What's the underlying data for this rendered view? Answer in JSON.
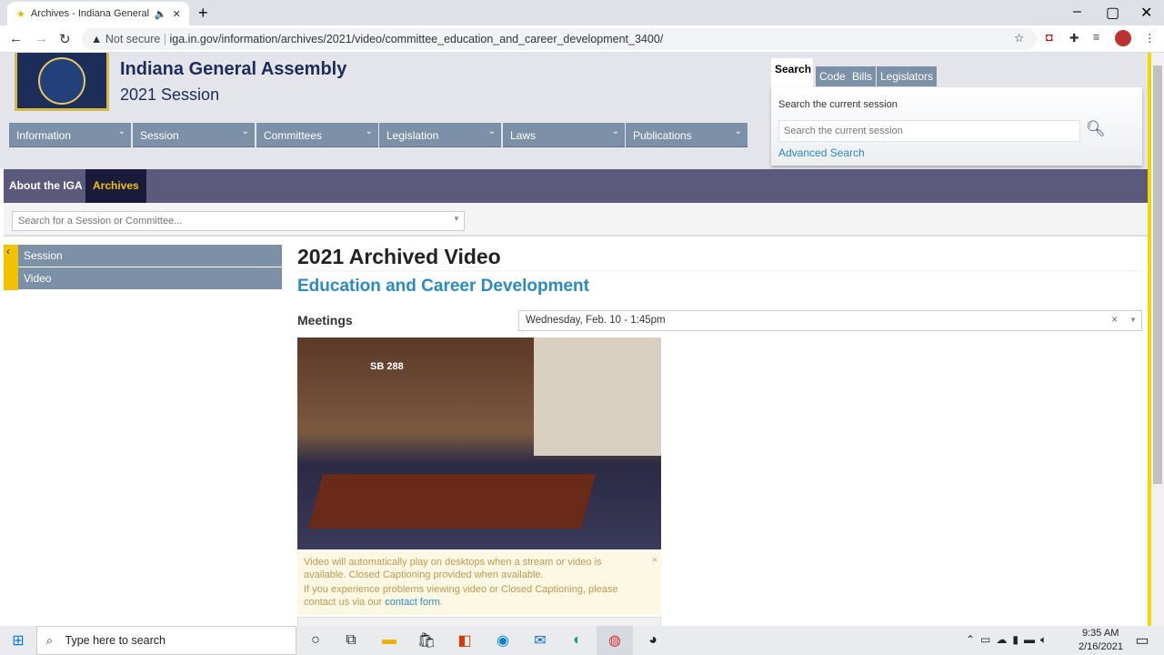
{
  "browser": {
    "tab_title": "Archives - Indiana General A",
    "not_secure": "Not secure",
    "url": "iga.in.gov/information/archives/2021/video/committee_education_and_career_development_3400/"
  },
  "header": {
    "title": "Indiana General Assembly",
    "session": "2021 Session"
  },
  "nav": [
    "Information",
    "Session",
    "Committees",
    "Legislation",
    "Laws",
    "Publications"
  ],
  "search_panel": {
    "tabs": [
      "Search",
      "Code",
      "Bills",
      "Legislators"
    ],
    "label": "Search the current session",
    "placeholder": "Search the current session",
    "advanced": "Advanced Search"
  },
  "subnav": [
    "About the IGA",
    "Archives"
  ],
  "session_search": {
    "placeholder": "Search for a Session or Committee..."
  },
  "sidebar": [
    "Session",
    "Video"
  ],
  "main": {
    "title": "2021 Archived Video",
    "committee": "Education and Career Development",
    "meetings_label": "Meetings",
    "meeting_selected": "Wednesday, Feb. 10 - 1:45pm",
    "video_caption": "SB 288",
    "notice_1": "Video will automatically play on desktops when a stream or video is available. Closed Captioning provided when available.",
    "notice_2": "If you experience problems viewing video or Closed Captioning, please contact us via our ",
    "notice_link": "contact form",
    "notice_end": "."
  },
  "taskbar": {
    "search_placeholder": "Type here to search",
    "time": "9:35 AM",
    "date": "2/16/2021"
  }
}
